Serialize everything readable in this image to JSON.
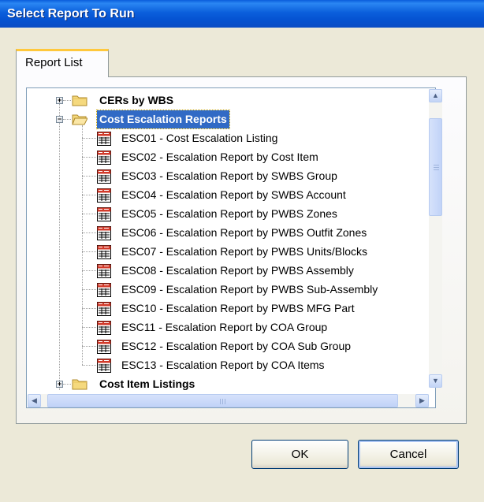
{
  "window": {
    "title": "Select Report To Run"
  },
  "tabs": [
    {
      "label": "Report List",
      "active": true
    }
  ],
  "tree": {
    "categories_before": [
      {
        "label": "CERs by WBS",
        "expanded": false
      }
    ],
    "expanded_category": {
      "label": "Cost Escalation Reports",
      "expanded": true,
      "selected": true
    },
    "reports": [
      {
        "label": "ESC01 - Cost Escalation Listing"
      },
      {
        "label": "ESC02 - Escalation Report by Cost Item"
      },
      {
        "label": "ESC03 - Escalation Report by SWBS Group"
      },
      {
        "label": "ESC04 - Escalation Report by SWBS Account"
      },
      {
        "label": "ESC05 - Escalation Report by PWBS Zones"
      },
      {
        "label": "ESC06 - Escalation Report by PWBS Outfit Zones"
      },
      {
        "label": "ESC07 - Escalation Report by PWBS Units/Blocks"
      },
      {
        "label": "ESC08 - Escalation Report by PWBS Assembly"
      },
      {
        "label": "ESC09 - Escalation Report by PWBS Sub-Assembly"
      },
      {
        "label": "ESC10 - Escalation Report by PWBS MFG Part"
      },
      {
        "label": "ESC11 - Escalation Report by COA Group"
      },
      {
        "label": "ESC12 - Escalation Report by COA Sub Group"
      },
      {
        "label": "ESC13 - Escalation Report by COA Items"
      }
    ],
    "categories_after": [
      {
        "label": "Cost Item Listings",
        "expanded": false
      }
    ]
  },
  "icons": {
    "expand": "plus-box-icon",
    "collapse": "minus-box-icon",
    "closed_folder": "folder-icon",
    "open_folder": "folder-open-icon",
    "report": "report-icon"
  },
  "colors": {
    "selection": "#316ac5",
    "titlebar": "#0a5ddb",
    "tab_accent": "#ffc83c"
  },
  "buttons": {
    "ok": "OK",
    "cancel": "Cancel"
  }
}
